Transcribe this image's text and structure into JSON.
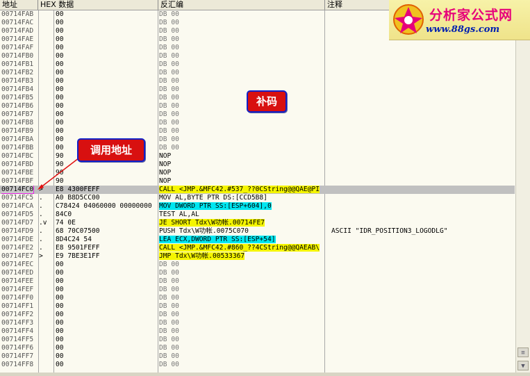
{
  "header": {
    "addr": "地址",
    "hex": "HEX 数据",
    "disasm": "反汇编",
    "comment": "注释"
  },
  "logo": {
    "title": "分析家公式网",
    "url": "www.88gs.com"
  },
  "callouts": {
    "patch": "补码",
    "call_address": "调用地址"
  },
  "colors": {
    "highlight_yellow": "#f5f500",
    "highlight_cyan": "#00e6f0",
    "selection": "#c0c0c0",
    "callout_red": "#d81010"
  },
  "rows": [
    {
      "addr": "00714FAB",
      "mk": "",
      "hex": "00",
      "dis": "DB 00",
      "cmt": ""
    },
    {
      "addr": "00714FAC",
      "mk": "",
      "hex": "00",
      "dis": "DB 00",
      "cmt": ""
    },
    {
      "addr": "00714FAD",
      "mk": "",
      "hex": "00",
      "dis": "DB 00",
      "cmt": ""
    },
    {
      "addr": "00714FAE",
      "mk": "",
      "hex": "00",
      "dis": "DB 00",
      "cmt": ""
    },
    {
      "addr": "00714FAF",
      "mk": "",
      "hex": "00",
      "dis": "DB 00",
      "cmt": ""
    },
    {
      "addr": "00714FB0",
      "mk": "",
      "hex": "00",
      "dis": "DB 00",
      "cmt": ""
    },
    {
      "addr": "00714FB1",
      "mk": "",
      "hex": "00",
      "dis": "DB 00",
      "cmt": ""
    },
    {
      "addr": "00714FB2",
      "mk": "",
      "hex": "00",
      "dis": "DB 00",
      "cmt": ""
    },
    {
      "addr": "00714FB3",
      "mk": "",
      "hex": "00",
      "dis": "DB 00",
      "cmt": ""
    },
    {
      "addr": "00714FB4",
      "mk": "",
      "hex": "00",
      "dis": "DB 00",
      "cmt": ""
    },
    {
      "addr": "00714FB5",
      "mk": "",
      "hex": "00",
      "dis": "DB 00",
      "cmt": ""
    },
    {
      "addr": "00714FB6",
      "mk": "",
      "hex": "00",
      "dis": "DB 00",
      "cmt": ""
    },
    {
      "addr": "00714FB7",
      "mk": "",
      "hex": "00",
      "dis": "DB 00",
      "cmt": ""
    },
    {
      "addr": "00714FB8",
      "mk": "",
      "hex": "00",
      "dis": "DB 00",
      "cmt": ""
    },
    {
      "addr": "00714FB9",
      "mk": "",
      "hex": "00",
      "dis": "DB 00",
      "cmt": ""
    },
    {
      "addr": "00714FBA",
      "mk": "",
      "hex": "00",
      "dis": "DB 00",
      "cmt": ""
    },
    {
      "addr": "00714FBB",
      "mk": "",
      "hex": "00",
      "dis": "DB 00",
      "cmt": ""
    },
    {
      "addr": "00714FBC",
      "mk": "",
      "hex": "90",
      "dis": "NOP",
      "cmt": ""
    },
    {
      "addr": "00714FBD",
      "mk": "",
      "hex": "90",
      "dis": "NOP",
      "cmt": ""
    },
    {
      "addr": "00714FBE",
      "mk": "",
      "hex": "90",
      "dis": "NOP",
      "cmt": ""
    },
    {
      "addr": "00714FBF",
      "mk": "",
      "hex": "90",
      "dis": "NOP",
      "cmt": ""
    },
    {
      "addr": "00714FC0",
      "mk": ">",
      "hex": "E8 4300FEFF",
      "dis": "CALL <JMP.&MFC42.#537_??0CString@@QAE@PI",
      "cmt": ""
    },
    {
      "addr": "00714FC5",
      "mk": ".",
      "hex": "A0 B8D5CC00",
      "dis": "MOV AL,BYTE PTR DS:[CCD5B8]",
      "cmt": ""
    },
    {
      "addr": "00714FCA",
      "mk": ".",
      "hex": "C78424 04060000 00000000",
      "dis": "MOV DWORD PTR SS:[ESP+604],0",
      "cmt": ""
    },
    {
      "addr": "00714FD5",
      "mk": ".",
      "hex": "84C0",
      "dis": "TEST AL,AL",
      "cmt": ""
    },
    {
      "addr": "00714FD7",
      "mk": ".v",
      "hex": "74 0E",
      "dis": "JE SHORT Tdx\\W功帐.00714FE7",
      "cmt": ""
    },
    {
      "addr": "00714FD9",
      "mk": ".",
      "hex": "68 70C07500",
      "dis": "PUSH Tdx\\W功帐.0075C070",
      "cmt": "ASCII \"IDR_POSITION3_LOGODLG\""
    },
    {
      "addr": "00714FDE",
      "mk": ".",
      "hex": "8D4C24 54",
      "dis": "LEA ECX,DWORD PTR SS:[ESP+54]",
      "cmt": ""
    },
    {
      "addr": "00714FE2",
      "mk": ".",
      "hex": "E8 9501FEFF",
      "dis": "CALL <JMP.&MFC42.#860_??4CString@@QAEAB\\",
      "cmt": ""
    },
    {
      "addr": "00714FE7",
      "mk": ">",
      "hex": "E9 7BE3E1FF",
      "dis": "JMP Tdx\\W功帐.00533367",
      "cmt": ""
    },
    {
      "addr": "00714FEC",
      "mk": "",
      "hex": "00",
      "dis": "DB 00",
      "cmt": ""
    },
    {
      "addr": "00714FED",
      "mk": "",
      "hex": "00",
      "dis": "DB 00",
      "cmt": ""
    },
    {
      "addr": "00714FEE",
      "mk": "",
      "hex": "00",
      "dis": "DB 00",
      "cmt": ""
    },
    {
      "addr": "00714FEF",
      "mk": "",
      "hex": "00",
      "dis": "DB 00",
      "cmt": ""
    },
    {
      "addr": "00714FF0",
      "mk": "",
      "hex": "00",
      "dis": "DB 00",
      "cmt": ""
    },
    {
      "addr": "00714FF1",
      "mk": "",
      "hex": "00",
      "dis": "DB 00",
      "cmt": ""
    },
    {
      "addr": "00714FF2",
      "mk": "",
      "hex": "00",
      "dis": "DB 00",
      "cmt": ""
    },
    {
      "addr": "00714FF3",
      "mk": "",
      "hex": "00",
      "dis": "DB 00",
      "cmt": ""
    },
    {
      "addr": "00714FF4",
      "mk": "",
      "hex": "00",
      "dis": "DB 00",
      "cmt": ""
    },
    {
      "addr": "00714FF5",
      "mk": "",
      "hex": "00",
      "dis": "DB 00",
      "cmt": ""
    },
    {
      "addr": "00714FF6",
      "mk": "",
      "hex": "00",
      "dis": "DB 00",
      "cmt": ""
    },
    {
      "addr": "00714FF7",
      "mk": "",
      "hex": "00",
      "dis": "DB 00",
      "cmt": ""
    },
    {
      "addr": "00714FF8",
      "mk": "",
      "hex": "00",
      "dis": "DB 00",
      "cmt": ""
    }
  ]
}
